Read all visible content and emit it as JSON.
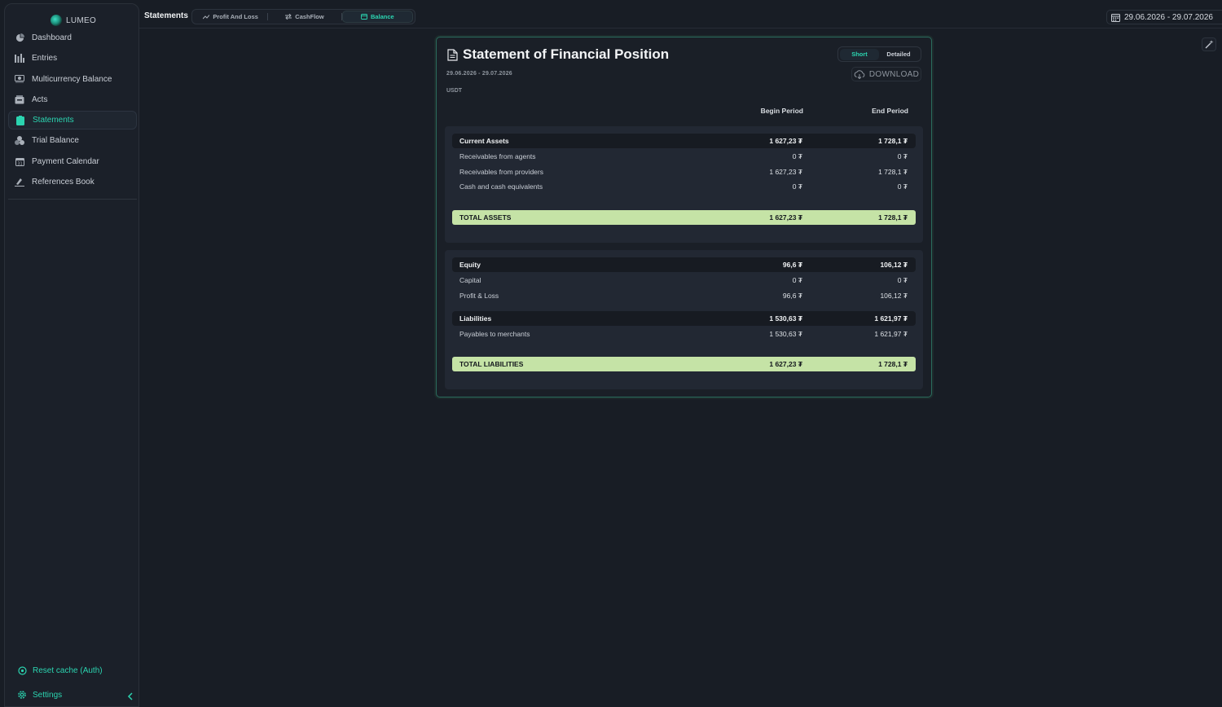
{
  "app": {
    "name": "LUMEO"
  },
  "sidebar": {
    "items": [
      {
        "label": "Dashboard",
        "icon": "pie-chart-icon",
        "active": false
      },
      {
        "label": "Entries",
        "icon": "bar-chart-icon",
        "active": false
      },
      {
        "label": "Multicurrency Balance",
        "icon": "coins-icon",
        "active": false
      },
      {
        "label": "Acts",
        "icon": "inbox-icon",
        "active": false
      },
      {
        "label": "Statements",
        "icon": "clipboard-icon",
        "active": true
      },
      {
        "label": "Trial Balance",
        "icon": "coins-stack-icon",
        "active": false
      },
      {
        "label": "Payment Calendar",
        "icon": "calendar-icon",
        "active": false
      },
      {
        "label": "References Book",
        "icon": "signature-icon",
        "active": false
      }
    ],
    "reset_cache": "Reset cache (Auth)",
    "settings": "Settings"
  },
  "header": {
    "title": "Statements",
    "tabs": [
      {
        "label": "Profit And Loss",
        "icon": "trend-icon"
      },
      {
        "label": "CashFlow",
        "icon": "swap-icon"
      },
      {
        "label": "Balance",
        "icon": "wallet-icon",
        "active": true
      }
    ],
    "date_range": "29.06.2026 - 29.07.2026"
  },
  "report": {
    "title": "Statement of Financial Position",
    "period": "29.06.2026 - 29.07.2026",
    "currency": "USDT",
    "view_short": "Short",
    "view_detailed": "Detailed",
    "download": "DOWNLOAD",
    "col_begin": "Begin Period",
    "col_end": "End Period",
    "assets": {
      "current_assets": {
        "label": "Current Assets",
        "begin": "1 627,23 ₮",
        "end": "1 728,1 ₮"
      },
      "items": [
        {
          "label": "Receivables from agents",
          "begin": "0 ₮",
          "end": "0 ₮"
        },
        {
          "label": "Receivables from providers",
          "begin": "1 627,23 ₮",
          "end": "1 728,1 ₮"
        },
        {
          "label": "Cash and cash equivalents",
          "begin": "0 ₮",
          "end": "0 ₮"
        }
      ],
      "total": {
        "label": "TOTAL ASSETS",
        "begin": "1 627,23 ₮",
        "end": "1 728,1 ₮"
      }
    },
    "liabilities": {
      "equity": {
        "label": "Equity",
        "begin": "96,6 ₮",
        "end": "106,12 ₮"
      },
      "equity_items": [
        {
          "label": "Capital",
          "begin": "0 ₮",
          "end": "0 ₮"
        },
        {
          "label": "Profit & Loss",
          "begin": "96,6 ₮",
          "end": "106,12 ₮"
        }
      ],
      "liabilities_group": {
        "label": "Liabilities",
        "begin": "1 530,63 ₮",
        "end": "1 621,97 ₮"
      },
      "liability_items": [
        {
          "label": "Payables to merchants",
          "begin": "1 530,63 ₮",
          "end": "1 621,97 ₮"
        }
      ],
      "total": {
        "label": "TOTAL LIABILITIES",
        "begin": "1 627,23 ₮",
        "end": "1 728,1 ₮"
      }
    }
  },
  "colors": {
    "accent": "#2bd4b0",
    "total_bg": "#c5e3a6",
    "card_border": "#2a6b5d"
  }
}
